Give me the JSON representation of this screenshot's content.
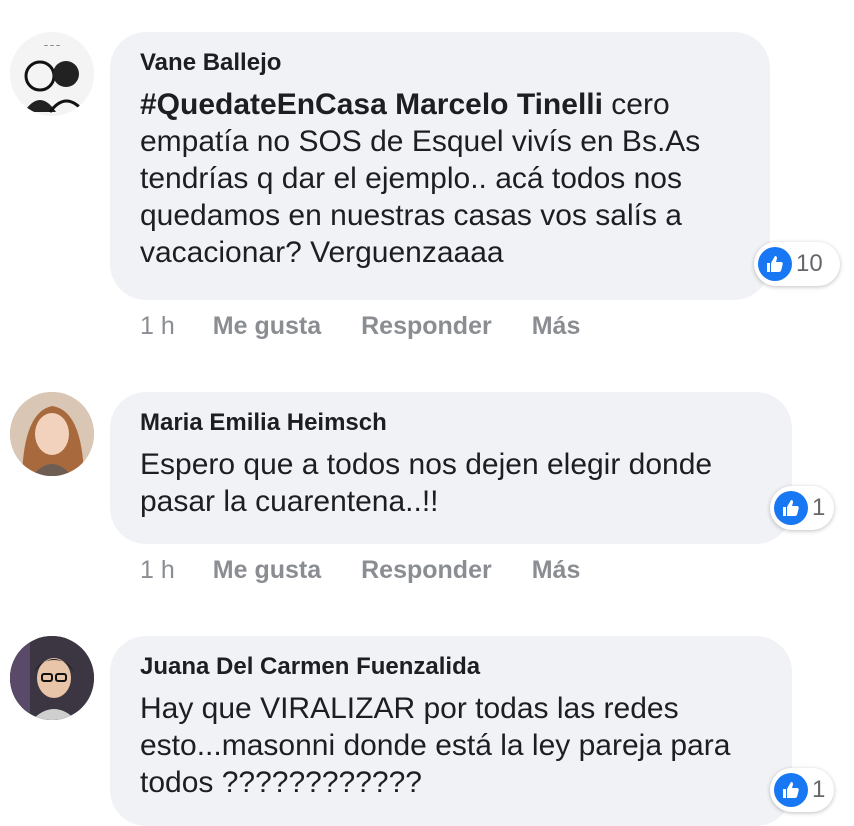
{
  "comments": [
    {
      "author": "Vane Ballejo",
      "hashtag": "#QuedateEnCasa Marcelo Tinelli",
      "text": " cero empatía no SOS de Esquel vivís en Bs.As tendrías q dar el ejemplo.. acá todos nos quedamos en nuestras casas vos salís a vacacionar? Verguenzaaaa",
      "likes": "10",
      "time": "1 h",
      "like_label": "Me gusta",
      "reply_label": "Responder",
      "more_label": "Más"
    },
    {
      "author": "Maria Emilia Heimsch",
      "text": "Espero que a todos nos dejen elegir donde pasar la cuarentena..!!",
      "likes": "1",
      "time": "1 h",
      "like_label": "Me gusta",
      "reply_label": "Responder",
      "more_label": "Más"
    },
    {
      "author": "Juana Del Carmen Fuenzalida",
      "text": "Hay que VIRALIZAR por todas las redes esto...masonni donde está la ley pareja para todos ????????????",
      "likes": "1"
    }
  ],
  "colors": {
    "like_blue": "#1877f2",
    "bubble_bg": "#f0f2f5",
    "meta_gray": "#8a8d91"
  }
}
